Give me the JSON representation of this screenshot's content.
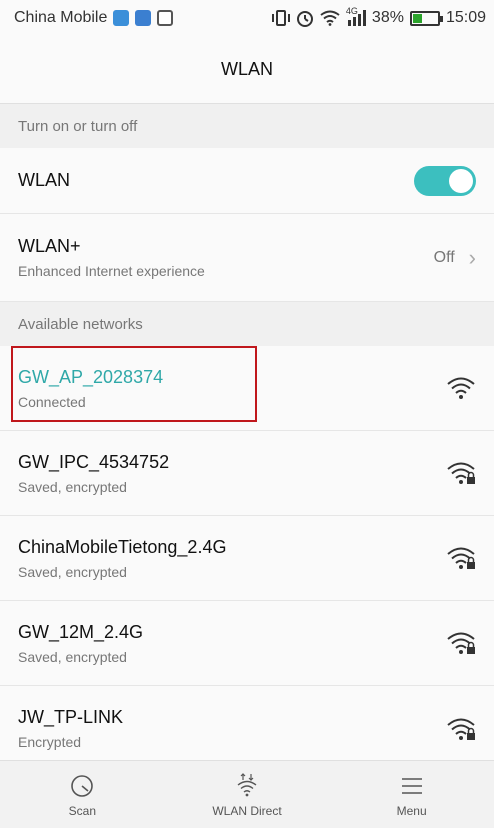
{
  "status_bar": {
    "carrier": "China Mobile",
    "network_type": "4G",
    "battery_percent_text": "38%",
    "battery_level": 0.38,
    "time": "15:09",
    "icons": [
      "vibrate-icon",
      "alarm-icon",
      "wifi-icon",
      "signal-icon",
      "battery-icon"
    ]
  },
  "header": {
    "title": "WLAN"
  },
  "toggle_section": {
    "header": "Turn on or turn off",
    "wlan_label": "WLAN",
    "wlan_enabled": true,
    "wlan_plus_label": "WLAN+",
    "wlan_plus_subtitle": "Enhanced Internet experience",
    "wlan_plus_value": "Off"
  },
  "networks_section": {
    "header": "Available networks",
    "networks": [
      {
        "ssid": "GW_AP_2028374",
        "status": "Connected",
        "locked": false
      },
      {
        "ssid": "GW_IPC_4534752",
        "status": "Saved, encrypted",
        "locked": true
      },
      {
        "ssid": "ChinaMobileTietong_2.4G",
        "status": "Saved, encrypted",
        "locked": true
      },
      {
        "ssid": "GW_12M_2.4G",
        "status": "Saved, encrypted",
        "locked": true
      },
      {
        "ssid": "JW_TP-LINK",
        "status": "Encrypted",
        "locked": true
      }
    ]
  },
  "bottom_bar": {
    "scan_label": "Scan",
    "wlan_direct_label": "WLAN Direct",
    "menu_label": "Menu"
  },
  "colors": {
    "accent": "#2fa8a8",
    "toggle_on": "#3cbfbf",
    "highlight_box": "#c0171c"
  }
}
